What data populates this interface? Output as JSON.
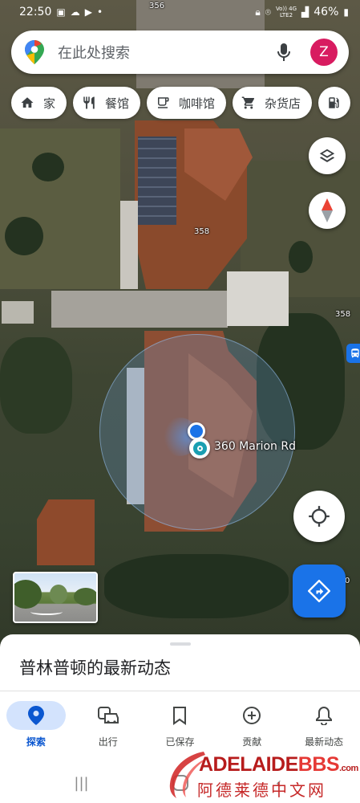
{
  "status_bar": {
    "time": "22:50",
    "network_small": "Vo)) 4G\nLTE2",
    "battery": "46%"
  },
  "search": {
    "placeholder": "在此处搜索",
    "avatar_letter": "Z"
  },
  "chips": [
    {
      "label": "家",
      "icon": "home-icon"
    },
    {
      "label": "餐馆",
      "icon": "restaurant-icon"
    },
    {
      "label": "咖啡馆",
      "icon": "coffee-icon"
    },
    {
      "label": "杂货店",
      "icon": "cart-icon"
    }
  ],
  "map": {
    "label_356": "356",
    "label_358_house": "358",
    "label_358_road": "358",
    "label_edge": "0",
    "place_label": "360 Marion Rd"
  },
  "sheet": {
    "title": "普林普顿的最新动态"
  },
  "bottom_nav": [
    {
      "label": "探索",
      "icon": "explore-pin-icon",
      "active": true
    },
    {
      "label": "出行",
      "icon": "commute-car-icon",
      "active": false
    },
    {
      "label": "已保存",
      "icon": "bookmark-icon",
      "active": false
    },
    {
      "label": "贡献",
      "icon": "add-circle-icon",
      "active": false
    },
    {
      "label": "最新动态",
      "icon": "bell-icon",
      "active": false
    }
  ],
  "watermark": {
    "brand_main": "ADELAIDE",
    "brand_accent": "BBS",
    "brand_suffix": ".com",
    "brand_cn": "阿德莱德中文网"
  },
  "colors": {
    "accent": "#1a73e8",
    "avatar": "#d81b60",
    "nav_active_bg": "#d3e3fd"
  }
}
